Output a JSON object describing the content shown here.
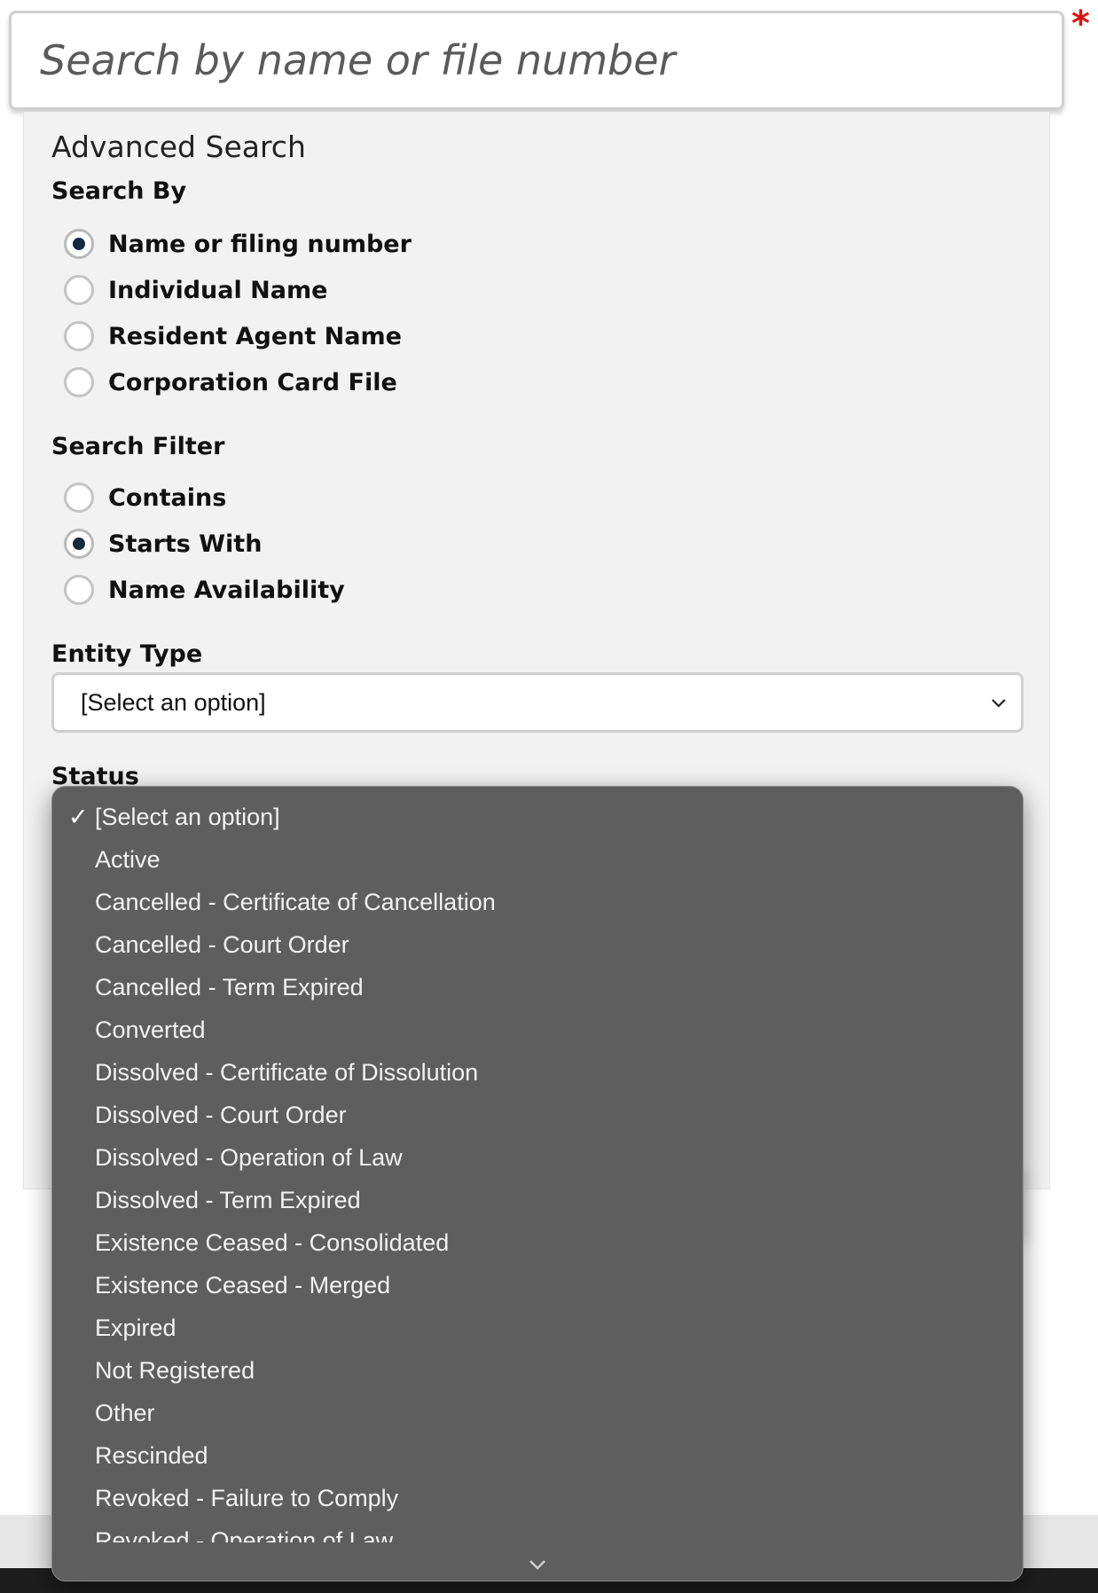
{
  "search": {
    "placeholder": "Search by name or file number",
    "required_marker": "*"
  },
  "advanced": {
    "title": "Advanced Search",
    "search_by": {
      "label": "Search By",
      "options": [
        {
          "label": "Name or filing number",
          "checked": true
        },
        {
          "label": "Individual Name",
          "checked": false
        },
        {
          "label": "Resident Agent Name",
          "checked": false
        },
        {
          "label": "Corporation Card File",
          "checked": false
        }
      ]
    },
    "search_filter": {
      "label": "Search Filter",
      "options": [
        {
          "label": "Contains",
          "checked": false
        },
        {
          "label": "Starts With",
          "checked": true
        },
        {
          "label": "Name Availability",
          "checked": false
        }
      ]
    },
    "entity_type": {
      "label": "Entity Type",
      "selected": "[Select an option]"
    },
    "status": {
      "label": "Status",
      "check_glyph": "✓",
      "options": [
        "[Select an option]",
        "Active",
        "Cancelled - Certificate of Cancellation",
        "Cancelled - Court Order",
        "Cancelled - Term Expired",
        "Converted",
        "Dissolved - Certificate of Dissolution",
        "Dissolved - Court Order",
        "Dissolved - Operation of Law",
        "Dissolved - Term Expired",
        "Existence Ceased - Consolidated",
        "Existence Ceased - Merged",
        "Expired",
        "Not Registered",
        "Other",
        "Rescinded",
        "Revoked - Failure to Comply",
        "Revoked - Operation of Law"
      ],
      "selected_index": 0
    }
  },
  "colors": {
    "radio_dot": "#162a3e",
    "dropdown_bg": "#5e5e5e",
    "required": "#e01010"
  }
}
